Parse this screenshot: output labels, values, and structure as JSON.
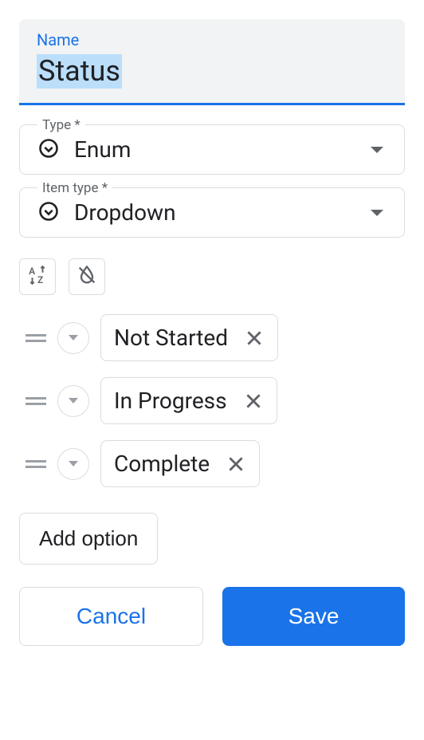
{
  "name": {
    "label": "Name",
    "value": "Status"
  },
  "type": {
    "label": "Type *",
    "value": "Enum"
  },
  "item_type": {
    "label": "Item type *",
    "value": "Dropdown"
  },
  "options": [
    {
      "label": "Not Started"
    },
    {
      "label": "In Progress"
    },
    {
      "label": "Complete"
    }
  ],
  "buttons": {
    "add_option": "Add option",
    "cancel": "Cancel",
    "save": "Save"
  }
}
